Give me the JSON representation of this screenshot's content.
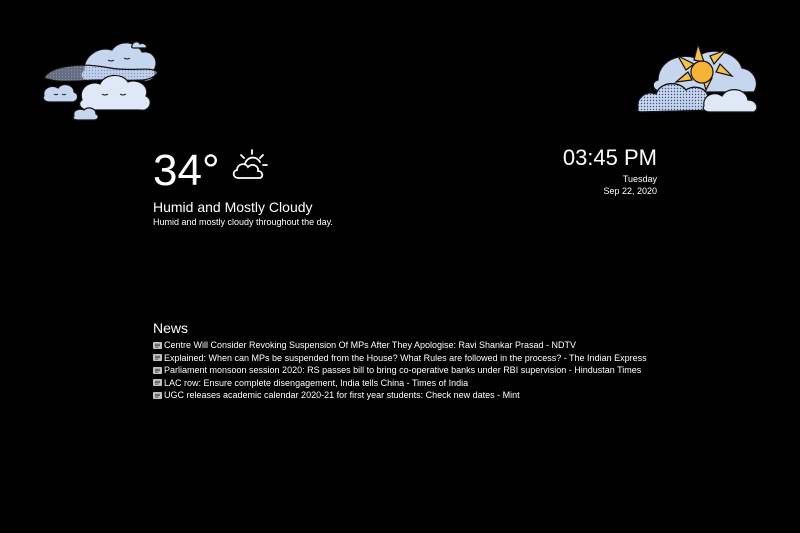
{
  "weather": {
    "temperature": "34°",
    "icon": "partly-cloudy-day-icon",
    "summary": "Humid and Mostly Cloudy",
    "description": "Humid and mostly cloudy throughout the day."
  },
  "clock": {
    "time": "03:45 PM",
    "day": "Tuesday",
    "date": "Sep 22, 2020"
  },
  "news": {
    "title": "News",
    "item_icon": "newspaper-icon",
    "items": [
      "Centre Will Consider Revoking Suspension Of MPs After They Apologise: Ravi Shankar Prasad - NDTV",
      "Explained: When can MPs be suspended from the House? What Rules are followed in the process? - The Indian Express",
      "Parliament monsoon session 2020: RS passes bill to bring co-operative banks under RBI supervision - Hindustan Times",
      "LAC row: Ensure complete disengagement, India tells China - Times of India",
      "UGC releases academic calendar 2020-21 for first year students: Check new dates - Mint"
    ]
  },
  "decorations": {
    "left": "clouds-icon",
    "right": "sun-behind-cloud-icon"
  },
  "colors": {
    "background": "#000000",
    "text": "#ffffff",
    "cloud": "#c7d6ef",
    "cloud_outline": "#1a1a1a",
    "sun": "#f7c04a"
  }
}
